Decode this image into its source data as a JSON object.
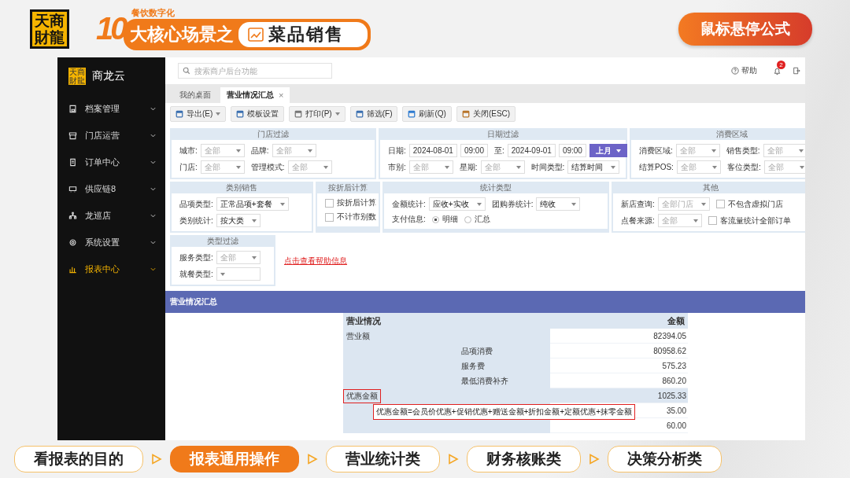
{
  "header": {
    "logo": "天商財龍",
    "number": "10",
    "subtitle": "餐饮数字化",
    "tagline": "大核心场景之",
    "topic": "菜品销售",
    "hint_button": "鼠标悬停公式"
  },
  "app": {
    "sidebar": {
      "logo": "天商財龍",
      "name": "商龙云",
      "items": [
        {
          "label": "档案管理",
          "selected": false
        },
        {
          "label": "门店运营",
          "selected": false
        },
        {
          "label": "订单中心",
          "selected": false
        },
        {
          "label": "供应链8",
          "selected": false
        },
        {
          "label": "龙巡店",
          "selected": false
        },
        {
          "label": "系统设置",
          "selected": false
        },
        {
          "label": "报表中心",
          "selected": true
        }
      ]
    },
    "search": {
      "placeholder": "搜索商户后台功能"
    },
    "help": "帮助",
    "notifications": "2",
    "tabs": [
      {
        "label": "我的桌面",
        "selected": false
      },
      {
        "label": "营业情况汇总",
        "selected": true,
        "close": "×"
      }
    ],
    "toolbar": [
      {
        "label": "导出(E)",
        "dropdown": true
      },
      {
        "label": "模板设置",
        "dropdown": false
      },
      {
        "label": "打印(P)",
        "dropdown": true
      },
      {
        "label": "筛选(F)",
        "dropdown": false
      },
      {
        "label": "刷新(Q)",
        "dropdown": false
      },
      {
        "label": "关闭(ESC)",
        "dropdown": false
      }
    ],
    "filter_rows": [
      [
        {
          "title": "门店过滤",
          "rows": [
            [
              {
                "kind": "label",
                "text": "城市:"
              },
              {
                "kind": "select",
                "placeholder": "全部"
              },
              {
                "kind": "label",
                "text": "品牌:"
              },
              {
                "kind": "select",
                "placeholder": "全部"
              }
            ],
            [
              {
                "kind": "label",
                "text": "门店:"
              },
              {
                "kind": "select",
                "placeholder": "全部"
              },
              {
                "kind": "label",
                "text": "管理模式:"
              },
              {
                "kind": "select",
                "placeholder": "全部"
              }
            ]
          ]
        },
        {
          "title": "日期过滤",
          "rows": [
            [
              {
                "kind": "label",
                "text": "日期:"
              },
              {
                "kind": "input",
                "value": "2024-08-01"
              },
              {
                "kind": "input",
                "value": "09:00"
              },
              {
                "kind": "label",
                "text": "至:"
              },
              {
                "kind": "input",
                "value": "2024-09-01"
              },
              {
                "kind": "input",
                "value": "09:00"
              },
              {
                "kind": "button",
                "text": "上月"
              }
            ],
            [
              {
                "kind": "label",
                "text": "市别:"
              },
              {
                "kind": "select",
                "placeholder": "全部"
              },
              {
                "kind": "label",
                "text": "星期:"
              },
              {
                "kind": "select",
                "placeholder": "全部"
              },
              {
                "kind": "label",
                "text": "时间类型:"
              },
              {
                "kind": "select",
                "value": "结算时间"
              }
            ]
          ]
        },
        {
          "title": "消费区域",
          "rows": [
            [
              {
                "kind": "label",
                "text": "消费区域:"
              },
              {
                "kind": "select",
                "placeholder": "全部"
              },
              {
                "kind": "label",
                "text": "销售类型:"
              },
              {
                "kind": "select",
                "placeholder": "全部"
              }
            ],
            [
              {
                "kind": "label",
                "text": "结算POS:"
              },
              {
                "kind": "select",
                "placeholder": "全部"
              },
              {
                "kind": "label",
                "text": "客位类型:"
              },
              {
                "kind": "select",
                "placeholder": "全部"
              }
            ]
          ]
        }
      ],
      [
        {
          "title": "类别销售",
          "rows": [
            [
              {
                "kind": "label",
                "text": "品项类型:"
              },
              {
                "kind": "select",
                "value": "正常品项+套餐"
              }
            ],
            [
              {
                "kind": "label",
                "text": "类别统计:"
              },
              {
                "kind": "select",
                "value": "按大类"
              }
            ]
          ]
        },
        {
          "title": "按折后计算",
          "rows": [
            [
              {
                "kind": "checkbox",
                "text": "按折后计算",
                "checked": false
              }
            ],
            [
              {
                "kind": "checkbox",
                "text": "不计市别数",
                "checked": false
              }
            ]
          ]
        },
        {
          "title": "统计类型",
          "rows": [
            [
              {
                "kind": "label",
                "text": "金额统计:"
              },
              {
                "kind": "select",
                "value": "应收+实收"
              },
              {
                "kind": "label",
                "text": "团购券统计:"
              },
              {
                "kind": "select",
                "value": "纯收"
              }
            ],
            [
              {
                "kind": "label",
                "text": "支付信息:"
              },
              {
                "kind": "radio",
                "text": "明细",
                "selected": true
              },
              {
                "kind": "radio",
                "text": "汇总",
                "selected": false
              }
            ]
          ]
        },
        {
          "title": "其他",
          "rows": [
            [
              {
                "kind": "label",
                "text": "新店查询:"
              },
              {
                "kind": "select",
                "placeholder": "全部门店"
              },
              {
                "kind": "checkbox",
                "text": "不包含虚拟门店",
                "checked": false
              }
            ],
            [
              {
                "kind": "label",
                "text": "点餐来源:"
              },
              {
                "kind": "select",
                "placeholder": "全部"
              },
              {
                "kind": "checkbox",
                "text": "客流量统计全部订单",
                "checked": false
              }
            ]
          ]
        }
      ],
      [
        {
          "title": "类型过滤",
          "rows": [
            [
              {
                "kind": "label",
                "text": "服务类型:"
              },
              {
                "kind": "select",
                "placeholder": "全部"
              }
            ],
            [
              {
                "kind": "label",
                "text": "就餐类型:"
              },
              {
                "kind": "select"
              }
            ]
          ]
        }
      ]
    ],
    "help_link": "点击查看帮助信息",
    "report_title": "营业情况汇总",
    "table": {
      "columns": [
        "营业情况",
        "金额"
      ],
      "rows": [
        {
          "label": "营业额",
          "value": "82394.05",
          "highlighted": false,
          "children": [
            {
              "label": "品项消费",
              "value": "80958.62"
            },
            {
              "label": "服务费",
              "value": "575.23"
            },
            {
              "label": "最低消费补齐",
              "value": "860.20"
            }
          ]
        },
        {
          "label": "优惠金额",
          "value": "1025.33",
          "highlighted": true,
          "children": [
            {
              "value": "35.00"
            },
            {
              "value": "60.00"
            }
          ]
        }
      ]
    },
    "tooltip": "优惠金额=会员价优惠+促销优惠+赠送金额+折扣金额+定额优惠+抹零金额"
  },
  "steps": [
    {
      "label": "看报表的目的",
      "selected": false
    },
    {
      "label": "报表通用操作",
      "selected": true
    },
    {
      "label": "营业统计类",
      "selected": false
    },
    {
      "label": "财务核账类",
      "selected": false
    },
    {
      "label": "决策分析类",
      "selected": false
    }
  ]
}
